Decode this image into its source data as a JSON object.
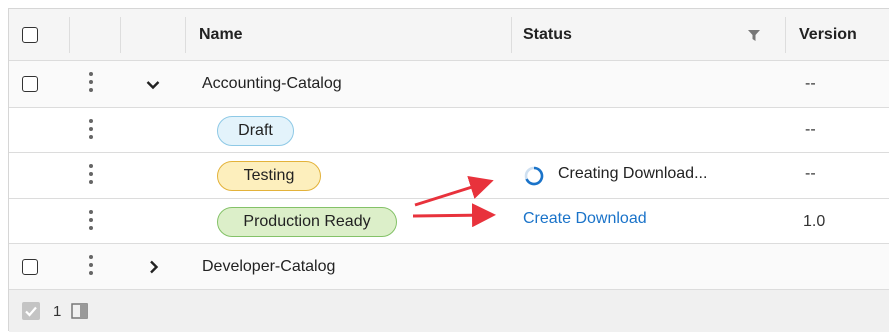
{
  "header": {
    "name_label": "Name",
    "status_label": "Status",
    "version_label": "Version"
  },
  "rows": [
    {
      "name": "Accounting-Catalog",
      "version": "--",
      "expanded": true
    },
    {
      "stage": "Draft",
      "version": "--"
    },
    {
      "stage": "Testing",
      "status": "Creating Download...",
      "version": "--"
    },
    {
      "stage": "Production Ready",
      "status": "Create Download",
      "version": "1.0"
    },
    {
      "name": "Developer-Catalog",
      "expanded": false
    }
  ],
  "footer": {
    "selected_count": "1"
  },
  "colors": {
    "link": "#1a73c9",
    "arrow": "#e8323c",
    "spinner": "#1a73c9",
    "draft": "#e3f3fb",
    "testing": "#fdefbd",
    "production": "#dcefc9"
  },
  "icons": [
    "checkbox-icon",
    "kebab-icon",
    "chevron-down-icon",
    "chevron-right-icon",
    "filter-icon",
    "spinner-icon",
    "arrow-icon",
    "columns-icon",
    "checkbox-checked-icon"
  ]
}
